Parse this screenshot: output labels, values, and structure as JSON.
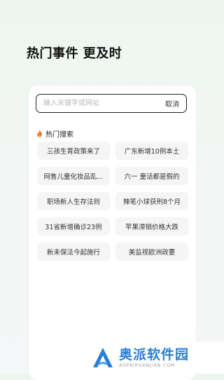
{
  "header": {
    "title": "热门事件 更及时"
  },
  "search": {
    "placeholder": "输入关键字或网址",
    "value": "",
    "cancel_label": "取消"
  },
  "hot": {
    "icon": "fire-icon",
    "icon_color": "#f26a1b",
    "label": "热门搜索",
    "items": [
      "三孩生育政策来了",
      "广东新增10例本土",
      "网售儿童化妆品乱...",
      "六一 童话都是假的",
      "职场新人生存法则",
      "辣笔小球获刑8个月",
      "31省新增确诊23例",
      "苹果滞销价格大跌",
      "新未保法今起施行",
      "美监视欧洲政要"
    ]
  },
  "watermark": {
    "title": "奥派软件园",
    "subtitle": "AOPAIRUANJIAN.COM",
    "color": "#2a7fd4"
  }
}
